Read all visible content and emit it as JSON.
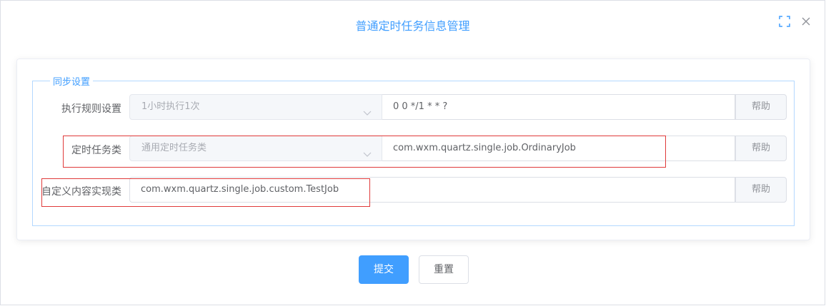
{
  "dialog": {
    "title": "普通定时任务信息管理",
    "maximize_icon": "fullscreen-icon",
    "close_icon": "close-icon"
  },
  "form": {
    "group_title": "同步设置",
    "rows": [
      {
        "label": "执行规则设置",
        "select_value": "1小时执行1次",
        "input_value": "0 0 */1 * * ?",
        "help_label": "帮助"
      },
      {
        "label": "定时任务类",
        "select_value": "通用定时任务类",
        "input_value": "com.wxm.quartz.single.job.OrdinaryJob",
        "help_label": "帮助"
      },
      {
        "label": "自定义内容实现类",
        "input_value": "com.wxm.quartz.single.job.custom.TestJob",
        "help_label": "帮助"
      }
    ]
  },
  "buttons": {
    "submit_label": "提交",
    "reset_label": "重置"
  },
  "colors": {
    "accent": "#409eff",
    "annotation": "#e03a3a"
  }
}
